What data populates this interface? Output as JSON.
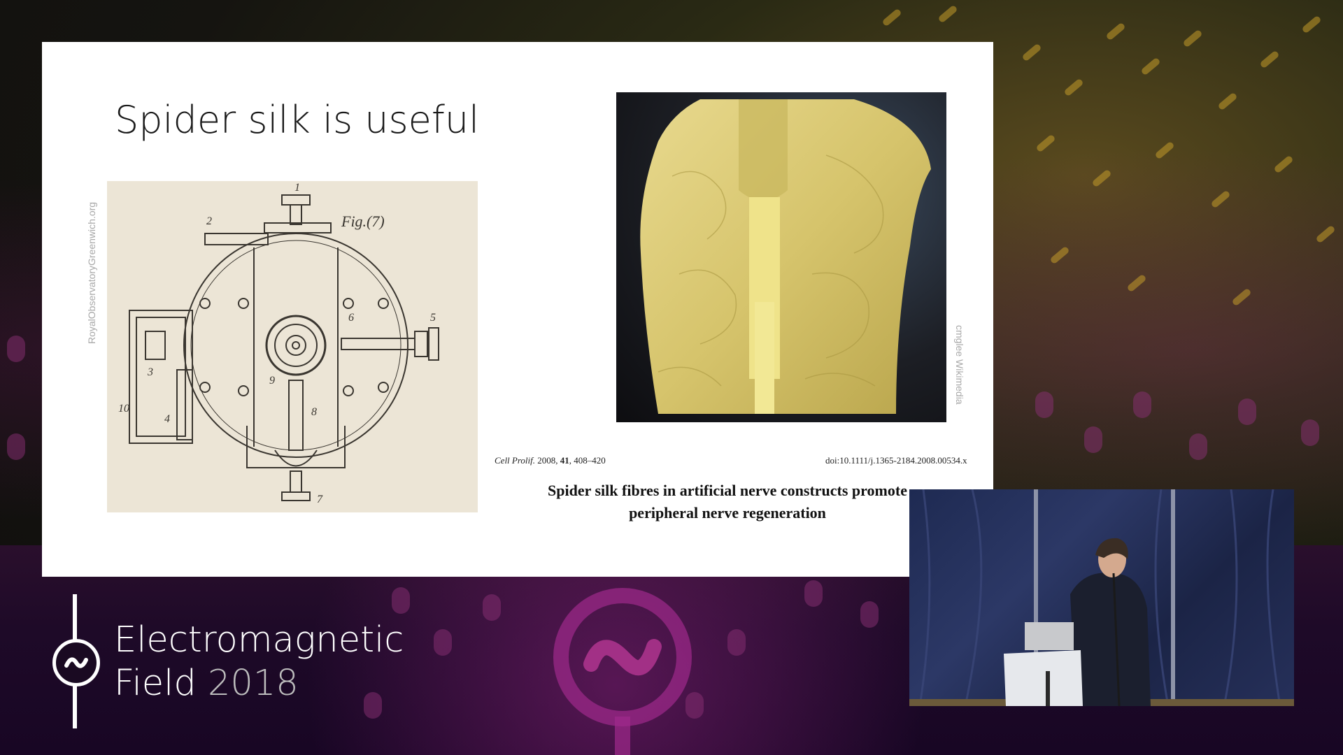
{
  "slide": {
    "title": "Spider silk is useful",
    "drawing": {
      "figure_label": "Fig.(7)",
      "part_numbers": [
        "1",
        "2",
        "3",
        "4",
        "5",
        "6",
        "7",
        "8",
        "9",
        "10"
      ],
      "credit": "RoyalObservatoryGreenwich.org"
    },
    "photo": {
      "subject": "golden spider silk cape",
      "credit": "cmglee Wikimedia"
    },
    "citation": {
      "journal": "Cell Prolif.",
      "year": "2008,",
      "volume": "41",
      "pages": ", 408–420",
      "doi": "doi:10.1111/j.1365-2184.2008.00534.x",
      "title_line1": "Spider silk fibres in artificial nerve constructs promote",
      "title_line2": "peripheral nerve regeneration"
    }
  },
  "branding": {
    "name_line1": "Electromagnetic",
    "name_line2": "Field",
    "year": "2018",
    "logo_icon": "tilde-circle-icon"
  },
  "speaker_video": {
    "subject": "speaker at podium with laptop"
  },
  "colors": {
    "slide_bg": "#ffffff",
    "accent_magenta": "#a02a8c",
    "accent_gold": "#c39a2a"
  }
}
